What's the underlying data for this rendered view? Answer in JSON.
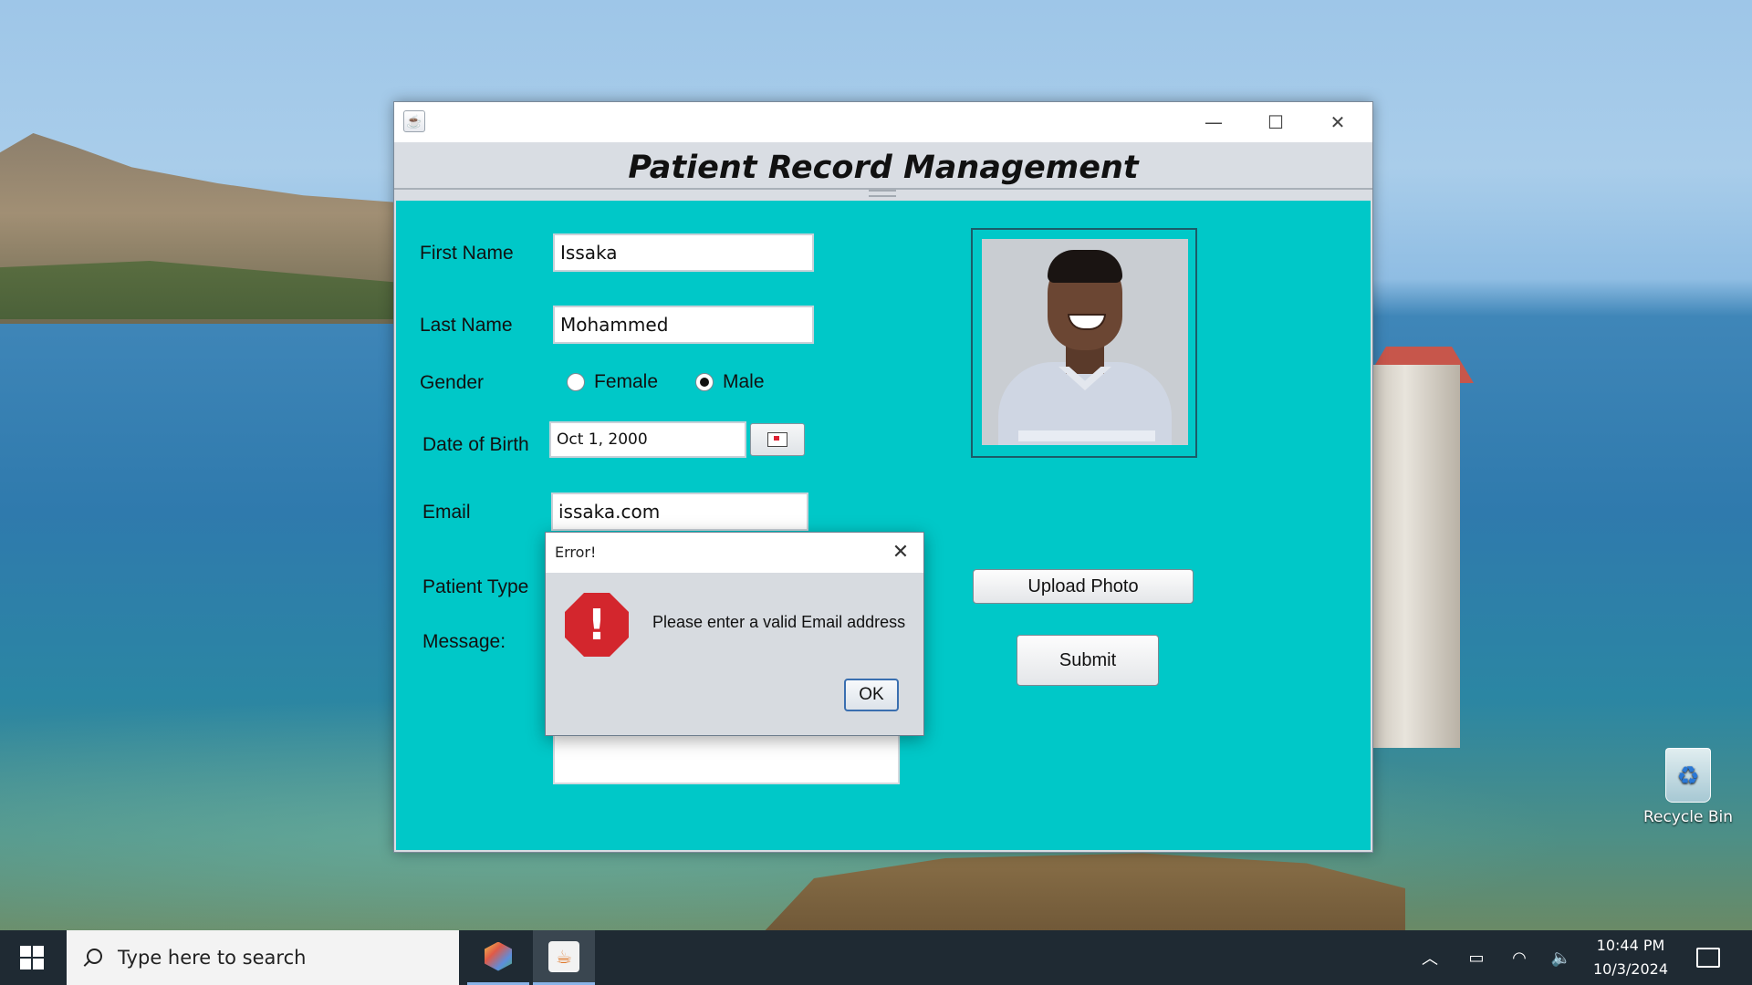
{
  "desktop": {
    "recycle_bin_label": "Recycle Bin"
  },
  "window": {
    "title": "Patient Record Management",
    "controls": {
      "minimize": "—",
      "maximize": "☐",
      "close": "✕"
    }
  },
  "form": {
    "first_name_label": "First Name",
    "first_name_value": "Issaka",
    "last_name_label": "Last Name",
    "last_name_value": "Mohammed",
    "gender_label": "Gender",
    "gender_options": [
      "Female",
      "Male"
    ],
    "gender_selected": "Male",
    "dob_label": "Date of Birth",
    "dob_value": "Oct 1, 2000",
    "email_label": "Email",
    "email_value": "issaka.com",
    "patient_type_label": "Patient Type",
    "message_label": "Message:",
    "message_value": "",
    "upload_photo_label": "Upload Photo",
    "submit_label": "Submit"
  },
  "dialog": {
    "title": "Error!",
    "message": "Please enter a valid Email address",
    "ok_label": "OK",
    "icon": "error-stop-icon"
  },
  "taskbar": {
    "search_placeholder": "Type here to search",
    "apps": [
      "netbeans-icon",
      "java-app-icon"
    ],
    "clock_time": "10:44 PM",
    "clock_date": "10/3/2024"
  },
  "colors": {
    "form_background": "#00c8c8",
    "taskbar": "#1f2a33",
    "error_red": "#d3262d"
  }
}
